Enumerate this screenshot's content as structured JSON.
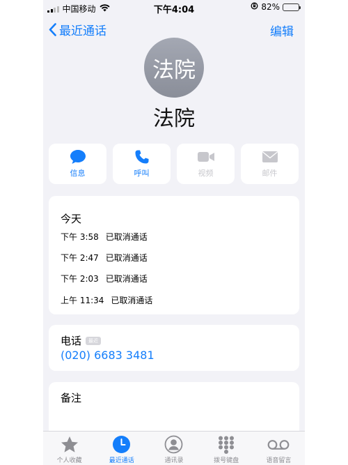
{
  "status_bar": {
    "carrier": "中国移动",
    "time": "下午4:04",
    "battery": "82%",
    "battery_level": 0.82
  },
  "nav": {
    "back_label": "最近通话",
    "edit_label": "编辑"
  },
  "contact": {
    "avatar_text": "法院",
    "name": "法院"
  },
  "actions": [
    {
      "label": "信息",
      "icon": "message-icon",
      "enabled": true
    },
    {
      "label": "呼叫",
      "icon": "phone-icon",
      "enabled": true
    },
    {
      "label": "视频",
      "icon": "video-icon",
      "enabled": false
    },
    {
      "label": "邮件",
      "icon": "mail-icon",
      "enabled": false
    }
  ],
  "recents": {
    "day": "今天",
    "calls": [
      {
        "time": "下午 3:58",
        "status": "已取消通话"
      },
      {
        "time": "下午 2:47",
        "status": "已取消通话"
      },
      {
        "time": "下午 2:03",
        "status": "已取消通话"
      },
      {
        "time": "上午 11:34",
        "status": "已取消通话"
      }
    ]
  },
  "phone": {
    "label": "电话",
    "badge": "最近",
    "number": "(020) 6683 3481"
  },
  "notes": {
    "label": "备注"
  },
  "tabs": [
    {
      "label": "个人收藏",
      "icon": "star-icon",
      "active": false
    },
    {
      "label": "最近通话",
      "icon": "clock-icon",
      "active": true
    },
    {
      "label": "通讯录",
      "icon": "contacts-icon",
      "active": false
    },
    {
      "label": "拨号键盘",
      "icon": "keypad-icon",
      "active": false
    },
    {
      "label": "语音留言",
      "icon": "voicemail-icon",
      "active": false
    }
  ],
  "colors": {
    "accent": "#147efb",
    "background": "#f2f2f7",
    "disabled": "#c7c7cc"
  }
}
